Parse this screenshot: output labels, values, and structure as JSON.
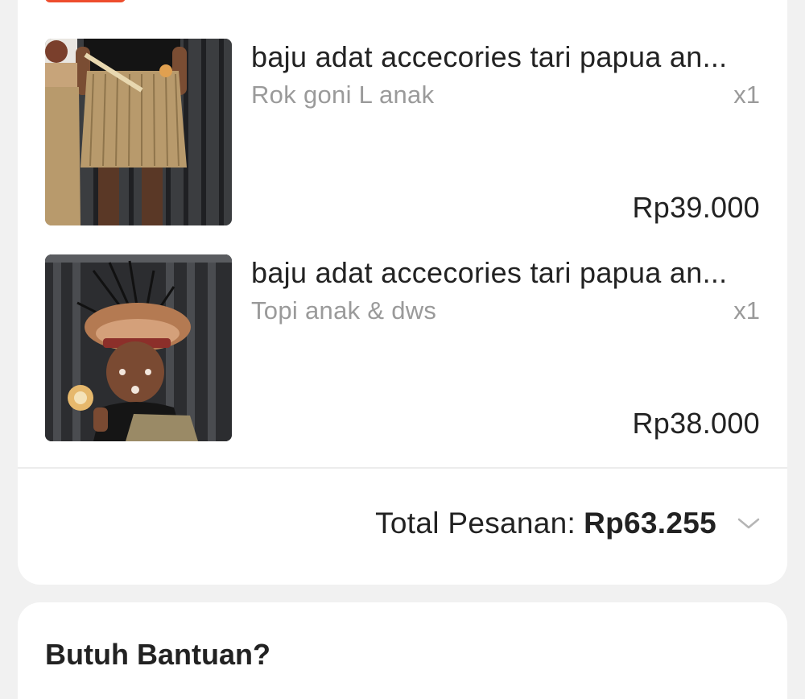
{
  "order": {
    "items": [
      {
        "name": "baju adat accecories tari papua an...",
        "variant": "Rok goni L anak",
        "quantity": "x1",
        "price": "Rp39.000",
        "image_icon": "grass-skirt-costume-photo"
      },
      {
        "name": "baju adat accecories tari papua an...",
        "variant": "Topi anak & dws",
        "quantity": "x1",
        "price": "Rp38.000",
        "image_icon": "feather-headdress-child-photo"
      }
    ],
    "total_label": "Total Pesanan:",
    "total_value": "Rp63.255",
    "expand_icon": "chevron-down-icon"
  },
  "next_section": {
    "title": "Butuh Bantuan?"
  },
  "colors": {
    "accent": "#ee4d2d",
    "background": "#f1f1f1",
    "card": "#ffffff",
    "muted_text": "#9a9a9a"
  }
}
